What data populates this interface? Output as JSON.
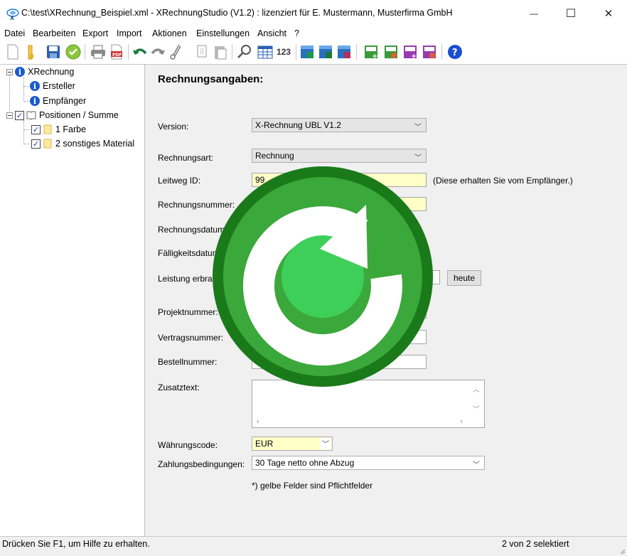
{
  "window": {
    "title": "C:\\test\\XRechnung_Beispiel.xml - XRechnungStudio (V1.2) : lizenziert für E. Mustermann, Musterfirma GmbH",
    "minimize": "—",
    "maximize": "☐",
    "close": "✕"
  },
  "menu": {
    "items": [
      "Datei",
      "Bearbeiten",
      "Export",
      "Import",
      "Aktionen",
      "Einstellungen",
      "Ansicht",
      "?"
    ]
  },
  "toolbar": {
    "icons": [
      "new-document-icon",
      "open-folder-icon",
      "save-icon",
      "validate-check-icon",
      "print-icon",
      "pdf-export-icon",
      "undo-icon",
      "redo-icon",
      "cut-icon",
      "copy-icon",
      "paste-icon",
      "search-icon",
      "table-icon",
      "numbering-icon",
      "xml-export-icon",
      "excel-export-icon",
      "access-export-icon",
      "add-item-icon",
      "edit-item-icon",
      "copy-item-icon",
      "delete-item-icon",
      "help-icon"
    ],
    "numbering_label": "123"
  },
  "tree": {
    "root": "XRechnung",
    "children": [
      "Ersteller",
      "Empfänger"
    ],
    "positions": "Positionen / Summe",
    "position_items": [
      "1 Farbe",
      "2 sonstiges Material"
    ]
  },
  "form": {
    "title": "Rechnungsangaben:",
    "version_label": "Version:",
    "version_value": "X-Rechnung UBL V1.2",
    "rechnungsart_label": "Rechnungsart:",
    "rechnungsart_value": "Rechnung",
    "leitweg_label": "Leitweg ID:",
    "leitweg_value": "99",
    "leitweg_hint": "(Diese erhalten Sie vom Empfänger.)",
    "rechnungsnummer_label": "Rechnungsnummer:",
    "rechnungsdatum_label": "Rechnungsdatum",
    "faelligkeitsdatum_label": "Fälligkeitsdatum",
    "leistung_label": "Leistung erbra",
    "heute_button": "heute",
    "projektnummer_label": "Projektnummer:",
    "vertragsnummer_label": "Vertragsnummer:",
    "bestellnummer_label": "Bestellnummer:",
    "zusatztext_label": "Zusatztext:",
    "waehrung_label": "Währungscode:",
    "waehrung_value": "EUR",
    "zahlungsbedingungen_label": "Zahlungsbedingungen:",
    "zahlungsbedingungen_value": "30 Tage netto ohne Abzug",
    "footnote": "*) gelbe Felder sind Pflichtfelder"
  },
  "status": {
    "left": "Drücken Sie F1, um Hilfe zu erhalten.",
    "right": "2 von 2 selektiert"
  },
  "colors": {
    "required_field": "#ffffc8",
    "overlay_green": "#3aa83a",
    "overlay_dark": "#1a7a1a"
  }
}
